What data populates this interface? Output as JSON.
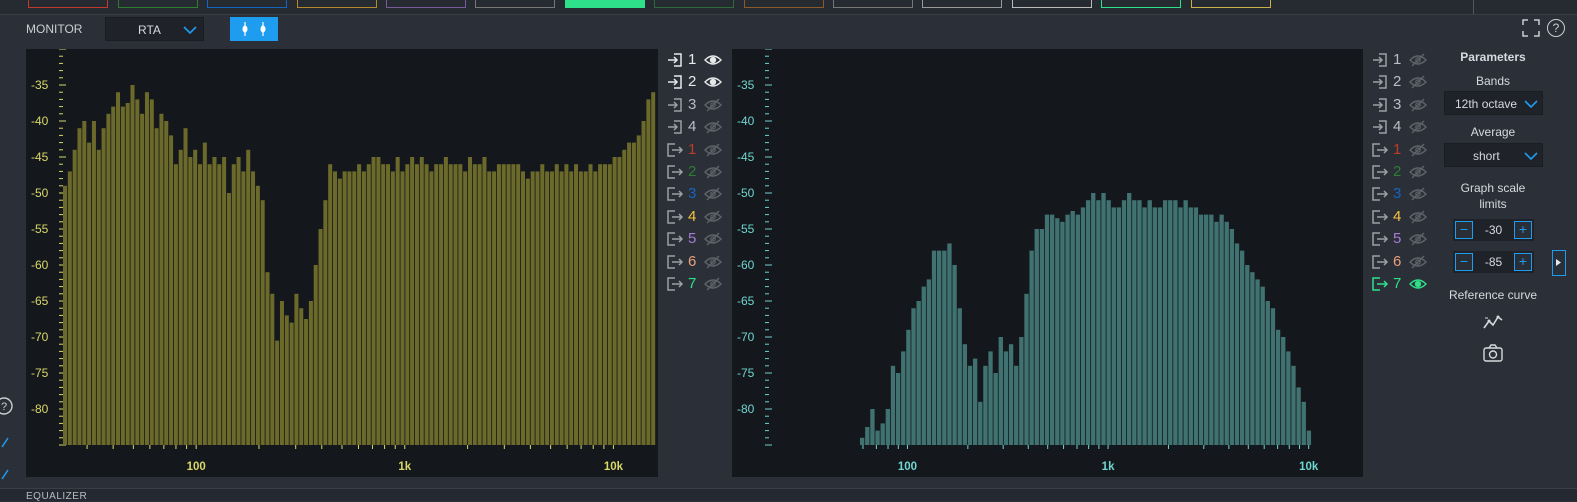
{
  "header": {
    "section_label": "MONITOR",
    "mode_select": {
      "value": "RTA"
    },
    "toggle_icon": "dual-marker-icon"
  },
  "colors": {
    "accent": "#1e9cf0",
    "bars_left": "#6b6a2a",
    "bars_right": "#3f7270",
    "axis_left": "#d9d86a",
    "axis_right": "#6fd6d0"
  },
  "graph_left": {
    "y_ticks": [
      "-35",
      "-40",
      "-45",
      "-50",
      "-55",
      "-60",
      "-65",
      "-70",
      "-75",
      "-80"
    ],
    "x_ticks": [
      "100",
      "1k",
      "10k"
    ]
  },
  "graph_right": {
    "y_ticks": [
      "-35",
      "-40",
      "-45",
      "-50",
      "-55",
      "-60",
      "-65",
      "-70",
      "-75",
      "-80"
    ],
    "x_ticks": [
      "100",
      "1k",
      "10k"
    ]
  },
  "chart_data": [
    {
      "type": "bar",
      "x_scale": "log",
      "ylim": [
        -85,
        -30
      ],
      "x_ticks": [
        "100",
        "1k",
        "10k"
      ],
      "y_ticks": [
        "-35",
        "-40",
        "-45",
        "-50",
        "-55",
        "-60",
        "-65",
        "-70",
        "-75",
        "-80"
      ],
      "values": [
        -49,
        -47,
        -44,
        -41,
        -40,
        -43,
        -40,
        -44,
        -41,
        -39,
        -38,
        -36,
        -38,
        -37.5,
        -35,
        -37,
        -39,
        -36,
        -37,
        -41,
        -39,
        -40,
        -42,
        -46,
        -44,
        -41,
        -45,
        -44,
        -46,
        -43,
        -46,
        -45,
        -46,
        -45,
        -50,
        -46,
        -45,
        -47,
        -44,
        -47,
        -49,
        -51,
        -61,
        -64,
        -70.5,
        -65,
        -67,
        -68,
        -64,
        -66,
        -67.5,
        -65,
        -60,
        -55,
        -51,
        -46,
        -47,
        -48,
        -47,
        -47,
        -47,
        -46,
        -47,
        -46,
        -45,
        -45,
        -46,
        -46,
        -47,
        -45,
        -47,
        -46,
        -45,
        -46,
        -45,
        -46,
        -47,
        -46,
        -46,
        -45,
        -46,
        -46,
        -46,
        -47,
        -45,
        -46,
        -46,
        -45,
        -47,
        -47,
        -46,
        -46,
        -46,
        -46,
        -46,
        -47,
        -48,
        -47,
        -47,
        -46,
        -47,
        -47,
        -46,
        -47,
        -46,
        -47,
        -46,
        -47,
        -47,
        -46,
        -47,
        -46,
        -46,
        -46,
        -45,
        -45,
        -44,
        -43,
        -43,
        -42,
        -40,
        -37,
        -36
      ]
    },
    {
      "type": "bar",
      "x_scale": "log",
      "ylim": [
        -85,
        -30
      ],
      "x_ticks": [
        "100",
        "1k",
        "10k"
      ],
      "y_ticks": [
        "-35",
        "-40",
        "-45",
        "-50",
        "-55",
        "-60",
        "-65",
        "-70",
        "-75",
        "-80"
      ],
      "values": [
        -84,
        -82.5,
        -80,
        -83,
        -82,
        -80,
        -74,
        -75,
        -72,
        -69,
        -66,
        -65,
        -63,
        -62,
        -58,
        -58,
        -58,
        -57,
        -60,
        -66,
        -71,
        -74,
        -73,
        -79,
        -74,
        -72,
        -75,
        -70,
        -72,
        -71,
        -74,
        -70,
        -64,
        -58,
        -55,
        -55,
        -53,
        -53,
        -53.5,
        -54,
        -53,
        -52.5,
        -53,
        -52,
        -51,
        -50,
        -51,
        -50,
        -51,
        -52,
        -52,
        -51,
        -50,
        -51,
        -51,
        -52,
        -51,
        -52,
        -52,
        -51,
        -51,
        -51,
        -52,
        -51,
        -52,
        -52,
        -53,
        -53,
        -53,
        -54,
        -53,
        -54,
        -55,
        -57,
        -58,
        -60,
        -61,
        -62,
        -63,
        -65,
        -66,
        -69,
        -70,
        -72,
        -74,
        -77,
        -79,
        -83,
        -85
      ]
    }
  ],
  "channels_left": [
    {
      "icon": "input-icon",
      "label": "1",
      "visible": true,
      "color": "#e6e8ea"
    },
    {
      "icon": "input-icon",
      "label": "2",
      "visible": true,
      "color": "#e6e8ea"
    },
    {
      "icon": "input-icon",
      "label": "3",
      "visible": false,
      "color": "#b9bec4"
    },
    {
      "icon": "input-icon",
      "label": "4",
      "visible": false,
      "color": "#b9bec4"
    },
    {
      "icon": "output-icon",
      "label": "1",
      "visible": false,
      "color": "#c0392b"
    },
    {
      "icon": "output-icon",
      "label": "2",
      "visible": false,
      "color": "#2e7d32"
    },
    {
      "icon": "output-icon",
      "label": "3",
      "visible": false,
      "color": "#1565c0"
    },
    {
      "icon": "output-icon",
      "label": "4",
      "visible": false,
      "color": "#f5c242"
    },
    {
      "icon": "output-icon",
      "label": "5",
      "visible": false,
      "color": "#a57bd4"
    },
    {
      "icon": "output-icon",
      "label": "6",
      "visible": false,
      "color": "#e8a07a"
    },
    {
      "icon": "output-icon",
      "label": "7",
      "visible": false,
      "color": "#2ee08a"
    }
  ],
  "channels_right": [
    {
      "icon": "input-icon",
      "label": "1",
      "visible": false,
      "color": "#b9bec4"
    },
    {
      "icon": "input-icon",
      "label": "2",
      "visible": false,
      "color": "#b9bec4"
    },
    {
      "icon": "input-icon",
      "label": "3",
      "visible": false,
      "color": "#b9bec4"
    },
    {
      "icon": "input-icon",
      "label": "4",
      "visible": false,
      "color": "#b9bec4"
    },
    {
      "icon": "output-icon",
      "label": "1",
      "visible": false,
      "color": "#c0392b"
    },
    {
      "icon": "output-icon",
      "label": "2",
      "visible": false,
      "color": "#2e7d32"
    },
    {
      "icon": "output-icon",
      "label": "3",
      "visible": false,
      "color": "#1565c0"
    },
    {
      "icon": "output-icon",
      "label": "4",
      "visible": false,
      "color": "#f5c242"
    },
    {
      "icon": "output-icon",
      "label": "5",
      "visible": false,
      "color": "#a57bd4"
    },
    {
      "icon": "output-icon",
      "label": "6",
      "visible": false,
      "color": "#e8a07a"
    },
    {
      "icon": "output-icon",
      "label": "7",
      "visible": true,
      "color": "#2ee08a"
    }
  ],
  "parameters": {
    "title": "Parameters",
    "bands_label": "Bands",
    "bands_value": "12th octave",
    "average_label": "Average",
    "average_value": "short",
    "scale_label_line1": "Graph scale",
    "scale_label_line2": "limits",
    "upper_limit": "-30",
    "lower_limit": "-85",
    "reference_label": "Reference curve"
  },
  "bottom": {
    "label": "EQUALIZER"
  }
}
